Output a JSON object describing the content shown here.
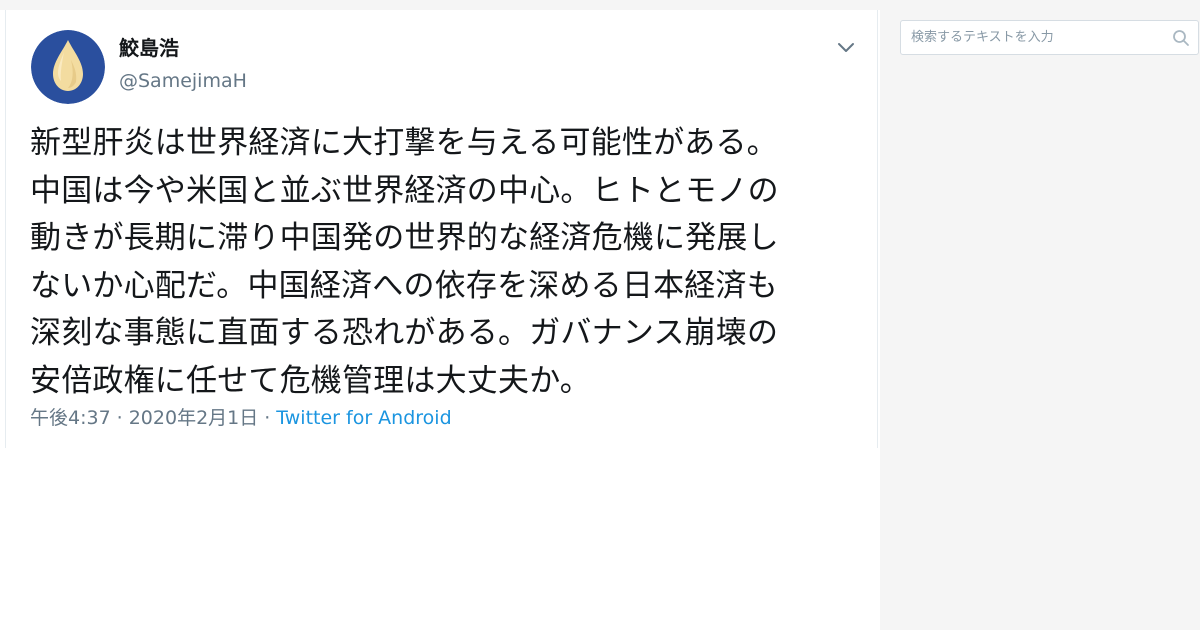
{
  "tweet": {
    "display_name": "鮫島浩",
    "handle": "@SamejimaH",
    "text": "新型肝炎は世界経済に大打撃を与える可能性がある。\n中国は今や米国と並ぶ世界経済の中心。ヒトとモノの\n動きが長期に滞り中国発の世界的な経済危機に発展し\nないか心配だ。中国経済への依存を深める日本経済も\n深刻な事態に直面する恐れがある。ガバナンス崩壊の\n安倍政権に任せて危機管理は大丈夫か。",
    "time": "午後4:37",
    "separator": "·",
    "date": "2020年2月1日",
    "client": "Twitter for Android"
  },
  "search": {
    "placeholder": "検索するテキストを入力"
  },
  "icons": {
    "menu": "chevron-down-icon",
    "search": "search-icon",
    "avatar": "water-drop-avatar"
  },
  "colors": {
    "link": "#1b95e0",
    "secondary_text": "#657786",
    "avatar_bg": "#2a4f9e",
    "avatar_drop": "#f3dca0"
  }
}
